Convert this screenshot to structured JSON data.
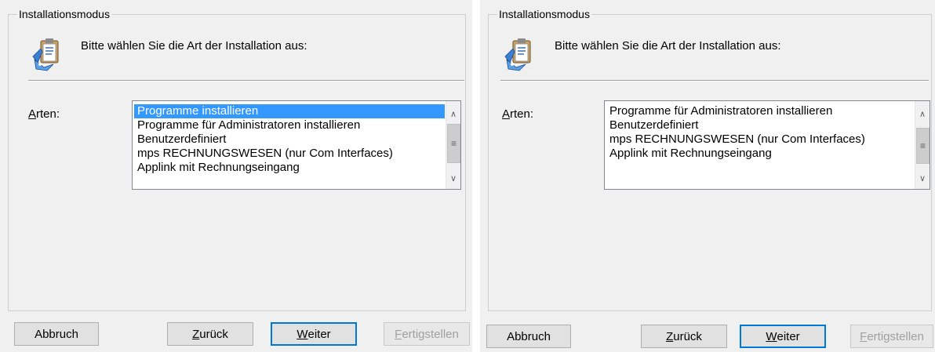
{
  "left_panel": {
    "group_title": "Installationsmodus",
    "heading": "Bitte wählen Sie die Art der Installation aus:",
    "field_label_accel": "A",
    "field_label_rest": "rten:",
    "list_items": [
      "Programme installieren",
      "Programme für Administratoren installieren",
      "Benutzerdefiniert",
      "mps RECHNUNGSWESEN (nur Com Interfaces)",
      "Applink mit Rechnungseingang"
    ],
    "selected_item": "Programme installieren",
    "buttons": {
      "cancel": "Abbruch",
      "back_accel": "Z",
      "back_rest": "urück",
      "next_accel": "W",
      "next_rest": "eiter",
      "finish_accel": "F",
      "finish_rest": "ertigstellen"
    }
  },
  "right_panel": {
    "group_title": "Installationsmodus",
    "heading": "Bitte wählen Sie die Art der Installation aus:",
    "field_label_accel": "A",
    "field_label_rest": "rten:",
    "list_items": [
      "Programme für Administratoren installieren",
      "Benutzerdefiniert",
      "mps RECHNUNGSWESEN (nur Com Interfaces)",
      "Applink mit Rechnungseingang"
    ],
    "buttons": {
      "cancel": "Abbruch",
      "back_accel": "Z",
      "back_rest": "urück",
      "next_accel": "W",
      "next_rest": "eiter",
      "finish_accel": "F",
      "finish_rest": "ertigstellen"
    }
  },
  "colors": {
    "selection": "#3399ff",
    "panel_bg": "#f0f0f0",
    "default_button_border": "#0078d7"
  },
  "icons": [
    "installer-wizard-icon",
    "scroll-up-arrow-icon",
    "scroll-down-arrow-icon",
    "scroll-grip-icon"
  ]
}
